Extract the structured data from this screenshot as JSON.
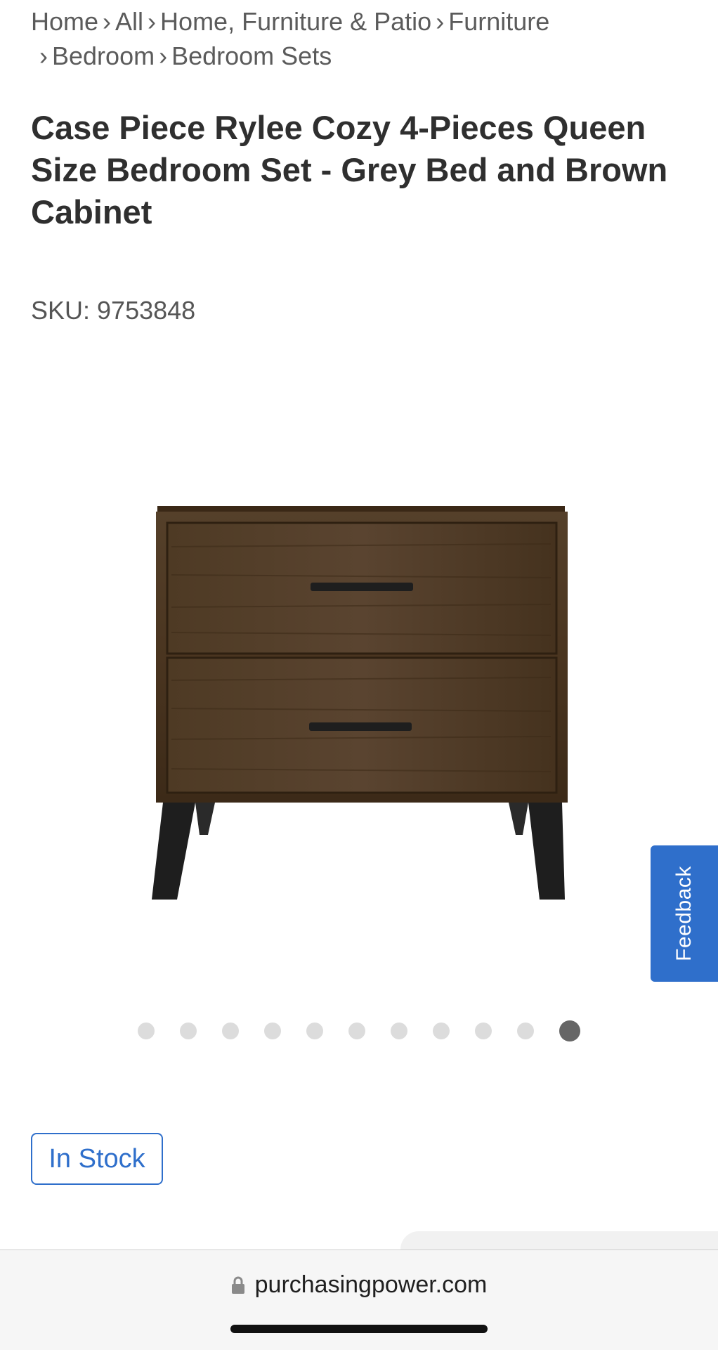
{
  "breadcrumb": {
    "items": [
      "Home",
      "All",
      "Home, Furniture & Patio",
      "Furniture",
      "Bedroom",
      "Bedroom Sets"
    ],
    "separator": "›"
  },
  "product": {
    "title": "Case Piece Rylee Cozy 4-Pieces Queen Size Bedroom Set - Grey Bed and Brown Cabinet",
    "sku": "SKU: 9753848",
    "stock_status": "In Stock"
  },
  "carousel": {
    "total": 11,
    "active_index": 11
  },
  "feedback": {
    "label": "Feedback"
  },
  "browser": {
    "url": "purchasingpower.com"
  },
  "colors": {
    "accent": "#2f6fcb",
    "wood": "#4a3520",
    "legs": "#1e1e1e",
    "dot_inactive": "#dcdcdc",
    "dot_active": "#666666"
  }
}
